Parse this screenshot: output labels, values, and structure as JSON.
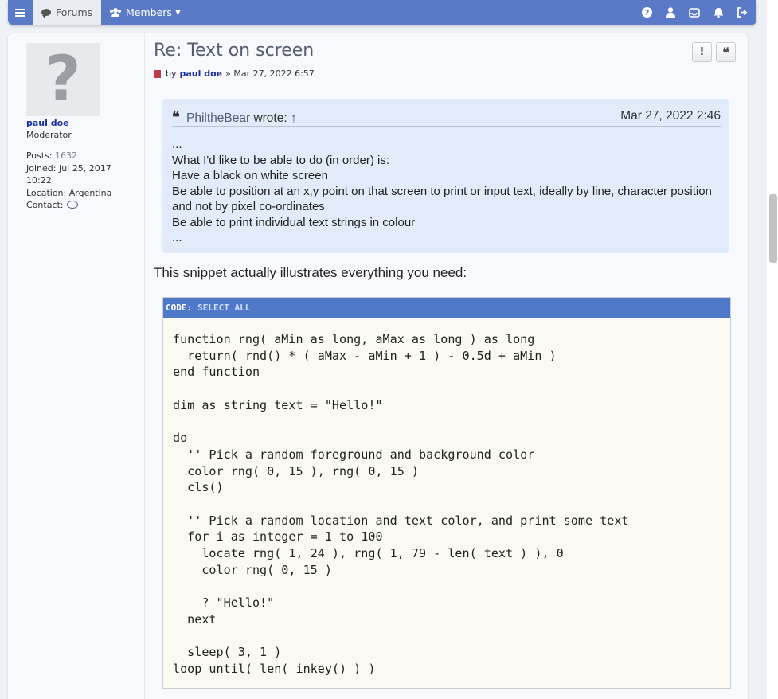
{
  "nav": {
    "forums_label": "Forums",
    "members_label": "Members",
    "icons": [
      "help-icon",
      "user-icon",
      "inbox-icon",
      "bell-icon",
      "logout-icon"
    ],
    "accent": "#5a7ac8"
  },
  "profile": {
    "avatar_glyph": "?",
    "username": "paul doe",
    "rank": "Moderator",
    "posts_label": "Posts:",
    "posts_value": "1632",
    "joined_label": "Joined:",
    "joined_value": "Jul 25, 2017",
    "joined_time": "10:22",
    "location_label": "Location:",
    "location_value": "Argentina",
    "contact_label": "Contact:"
  },
  "post": {
    "title": "Re: Text on screen",
    "by_label": "by",
    "author": "paul doe",
    "separator": "»",
    "date": "Mar 27, 2022 6:57",
    "report_glyph": "!",
    "quote_glyph": "❝"
  },
  "quote": {
    "author": "PhiltheBear",
    "wrote_label": "wrote:",
    "arrow": "↑",
    "date": "Mar 27, 2022 2:46",
    "lines": [
      "...",
      "What I'd like to be able to do (in order) is:",
      "Have a black on white screen",
      "Be able to position at an x,y point on that screen to print or input text, ideally by line, character position and not by pixel co-ordinates",
      "Be able to print individual text strings in colour",
      "..."
    ]
  },
  "snippet_intro": "This snippet actually illustrates everything you need:",
  "code": {
    "label": "CODE:",
    "select_all": "SELECT ALL",
    "text": "function rng( aMin as long, aMax as long ) as long\n  return( rnd() * ( aMax - aMin + 1 ) - 0.5d + aMin )\nend function\n\ndim as string text = \"Hello!\"\n\ndo\n  '' Pick a random foreground and background color\n  color rng( 0, 15 ), rng( 0, 15 )\n  cls()\n\n  '' Pick a random location and text color, and print some text\n  for i as integer = 1 to 100\n    locate rng( 1, 24 ), rng( 1, 79 - len( text ) ), 0\n    color rng( 0, 15 )\n\n    ? \"Hello!\"\n  next\n\n  sleep( 3, 1 )\nloop until( len( inkey() ) )"
  }
}
